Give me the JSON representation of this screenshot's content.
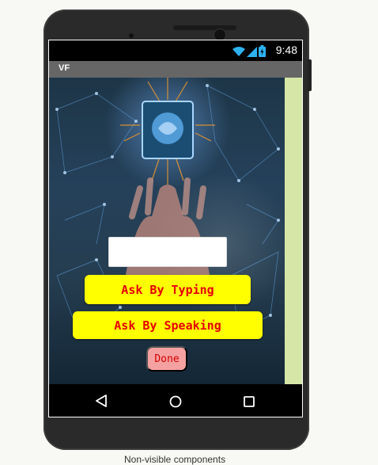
{
  "status_bar": {
    "time": "9:48",
    "icons": [
      "wifi-icon",
      "signal-icon",
      "battery-icon"
    ]
  },
  "app_bar": {
    "title": "VF"
  },
  "main": {
    "text_input": {
      "value": "",
      "placeholder": ""
    },
    "ask_typing_label": "Ask By Typing",
    "ask_speaking_label": "Ask By Speaking",
    "done_label": "Done"
  },
  "nav_bar": {
    "icons": [
      "back-icon",
      "home-icon",
      "recent-apps-icon"
    ]
  },
  "footer": {
    "non_visible_label": "Non-visible components"
  },
  "colors": {
    "button_bg": "#ffff00",
    "button_text": "#e60000",
    "done_bg": "#f6a1a1",
    "appbar_bg": "#666666"
  }
}
